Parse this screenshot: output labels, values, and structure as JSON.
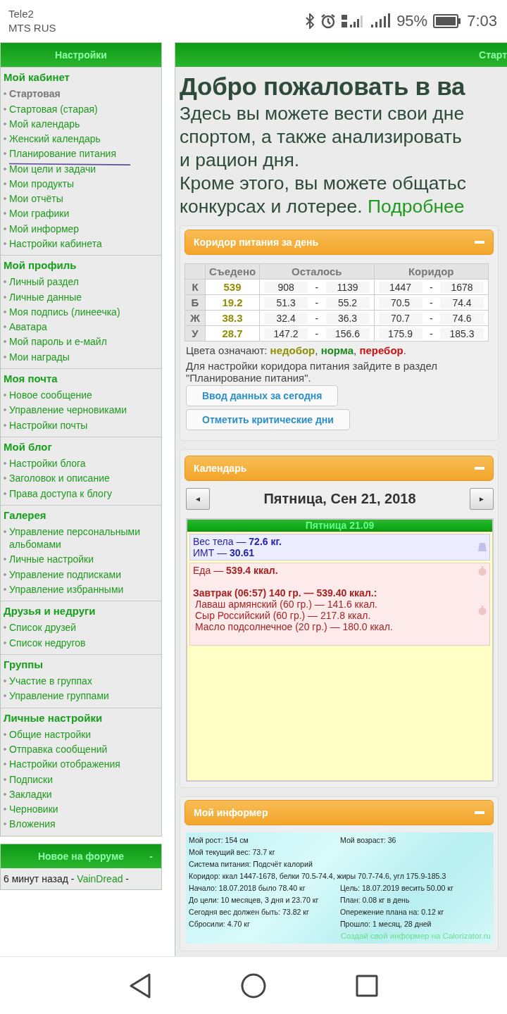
{
  "status_bar": {
    "carriers": [
      "Tele2",
      "MTS RUS"
    ],
    "battery_text": "95%",
    "time": "7:03"
  },
  "sidebar": {
    "title": "Настройки",
    "sections": [
      {
        "heading": "Мой кабинет",
        "items": [
          {
            "label": "Стартовая",
            "selected": true
          },
          {
            "label": "Стартовая (старая)",
            "selected": false
          },
          {
            "label": "Мой календарь",
            "selected": false
          },
          {
            "label": "Женский календарь",
            "selected": false
          },
          {
            "label": "Планирование питания",
            "selected": false
          },
          {
            "label": "Мои цели и задачи",
            "selected": false
          },
          {
            "label": "Мои продукты",
            "selected": false
          },
          {
            "label": "Мои отчёты",
            "selected": false
          },
          {
            "label": "Мои графики",
            "selected": false
          },
          {
            "label": "Мой информер",
            "selected": false
          },
          {
            "label": "Настройки кабинета",
            "selected": false
          }
        ]
      },
      {
        "heading": "Мой профиль",
        "items": [
          {
            "label": "Личный раздел",
            "selected": false
          },
          {
            "label": "Личные данные",
            "selected": false
          },
          {
            "label": "Моя подпись (линеечка)",
            "selected": false
          },
          {
            "label": "Аватара",
            "selected": false
          },
          {
            "label": "Мой пароль и е-майл",
            "selected": false
          },
          {
            "label": "Мои награды",
            "selected": false
          }
        ]
      },
      {
        "heading": "Моя почта",
        "items": [
          {
            "label": "Новое сообщение",
            "selected": false
          },
          {
            "label": "Управление черновиками",
            "selected": false
          },
          {
            "label": "Настройки почты",
            "selected": false
          }
        ]
      },
      {
        "heading": "Мой блог",
        "items": [
          {
            "label": "Настройки блога",
            "selected": false
          },
          {
            "label": "Заголовок и описание",
            "selected": false
          },
          {
            "label": "Права доступа к блогу",
            "selected": false
          }
        ]
      },
      {
        "heading": "Галерея",
        "items": [
          {
            "label": "Управление персональными альбомами",
            "selected": false
          },
          {
            "label": "Личные настройки",
            "selected": false
          },
          {
            "label": "Управление подписками",
            "selected": false
          },
          {
            "label": "Управление избранными",
            "selected": false
          }
        ]
      },
      {
        "heading": "Друзья и недруги",
        "items": [
          {
            "label": "Список друзей",
            "selected": false
          },
          {
            "label": "Список недругов",
            "selected": false
          }
        ]
      },
      {
        "heading": "Группы",
        "items": [
          {
            "label": "Участие в группах",
            "selected": false
          },
          {
            "label": "Управление группами",
            "selected": false
          }
        ]
      },
      {
        "heading": "Личные настройки",
        "items": [
          {
            "label": "Общие настройки",
            "selected": false
          },
          {
            "label": "Отправка сообщений",
            "selected": false
          },
          {
            "label": "Настройки отображения",
            "selected": false
          },
          {
            "label": "Подписки",
            "selected": false
          },
          {
            "label": "Закладки",
            "selected": false
          },
          {
            "label": "Черновики",
            "selected": false
          },
          {
            "label": "Вложения",
            "selected": false
          }
        ]
      }
    ]
  },
  "forum": {
    "title": "Новое на форуме",
    "toggle": "-",
    "post": {
      "prefix": "6 минут назад -",
      "author": "VainDread",
      "suffix": "-"
    }
  },
  "main": {
    "header": "Старт",
    "welcome_title": "Добро пожаловать в ва",
    "welcome_lines": [
      "Здесь вы можете вести свои дне",
      "спортом, а также анализировать",
      "и рацион дня.",
      "Кроме этого, вы можете общатьс",
      "конкурсах и лотерее."
    ],
    "welcome_link": "Подробнее"
  },
  "nutrition": {
    "title": "Коридор питания за день",
    "columns": [
      "Съедено",
      "Осталось",
      "Коридор"
    ],
    "range_separator": "-",
    "rows": [
      {
        "nutrient": "К",
        "eaten": "539",
        "color": "#8f8f00",
        "remaining": [
          "908",
          "1139"
        ],
        "corridor": [
          "1447",
          "1678"
        ]
      },
      {
        "nutrient": "Б",
        "eaten": "19.2",
        "color": "#8f8f00",
        "remaining": [
          "51.3",
          "55.2"
        ],
        "corridor": [
          "70.5",
          "74.4"
        ]
      },
      {
        "nutrient": "Ж",
        "eaten": "38.3",
        "color": "#8f8f00",
        "remaining": [
          "32.4",
          "36.3"
        ],
        "corridor": [
          "70.7",
          "74.6"
        ]
      },
      {
        "nutrient": "У",
        "eaten": "28.7",
        "color": "#8f8f00",
        "remaining": [
          "147.2",
          "156.6"
        ],
        "corridor": [
          "175.9",
          "185.3"
        ]
      }
    ],
    "legend": {
      "label": "Цвета означают:",
      "separator": ",",
      "end": ".",
      "items": [
        {
          "text": "недобор",
          "color": "#8f8f00"
        },
        {
          "text": "норма",
          "color": "#1a8a1a"
        },
        {
          "text": "перебор",
          "color": "#cc1111"
        }
      ]
    },
    "note": "Для настройки коридора питания зайдите в раздел \"Планирование питания\".",
    "buttons": [
      "Ввод данных за сегодня",
      "Отметить критические дни"
    ]
  },
  "calendar": {
    "title": "Календарь",
    "prev": "◄",
    "next": "►",
    "date": "Пятница, Сен 21, 2018",
    "day_title": "Пятница 21.09",
    "entries": [
      {
        "kind": "weight",
        "lines": [
          "Вес тела — **72.6 кг.**",
          "ИМТ — **30.61**"
        ]
      },
      {
        "kind": "food",
        "lines": [
          "Еда — **539.4 ккал.**"
        ],
        "meal": "Завтрак (06:57) 140 гр. — 539.40 ккал.:",
        "items": [
          "Лаваш армянский (60 гр.) — 141.6 ккал.",
          "Сыр Российский (60 гр.) — 217.8 ккал.",
          "Масло подсолнечное (20 гр.) — 180.0 ккал."
        ]
      }
    ]
  },
  "informer": {
    "title": "Мой информер",
    "rows": [
      [
        "Мой рост: 154 см",
        "Мой возраст: 36"
      ],
      [
        "Мой текущий вес: 73.7 кг"
      ],
      [
        "Система питания: Подсчёт калорий"
      ],
      [
        "Коридор: ккал 1447-1678, белки 70.5-74.4, жиры 70.7-74.6, угл 175.9-185.3"
      ],
      [
        "Начало: 18.07.2018 было 78.40 кг",
        "Цель: 18.07.2019 весить 50.00 кг"
      ],
      [
        "До цели: 10 месяцев, 3 дня и 23.70 кг",
        "План: 0.08 кг в день"
      ],
      [
        "Сегодня вес должен быть: 73.82 кг",
        "Опережение плана на: 0.12 кг"
      ],
      [
        "Сбросили: 4.70 кг",
        "Прошло: 1 месяц, 28 дней"
      ]
    ],
    "footer": "Создай свой информер на Calorizator.ru"
  }
}
